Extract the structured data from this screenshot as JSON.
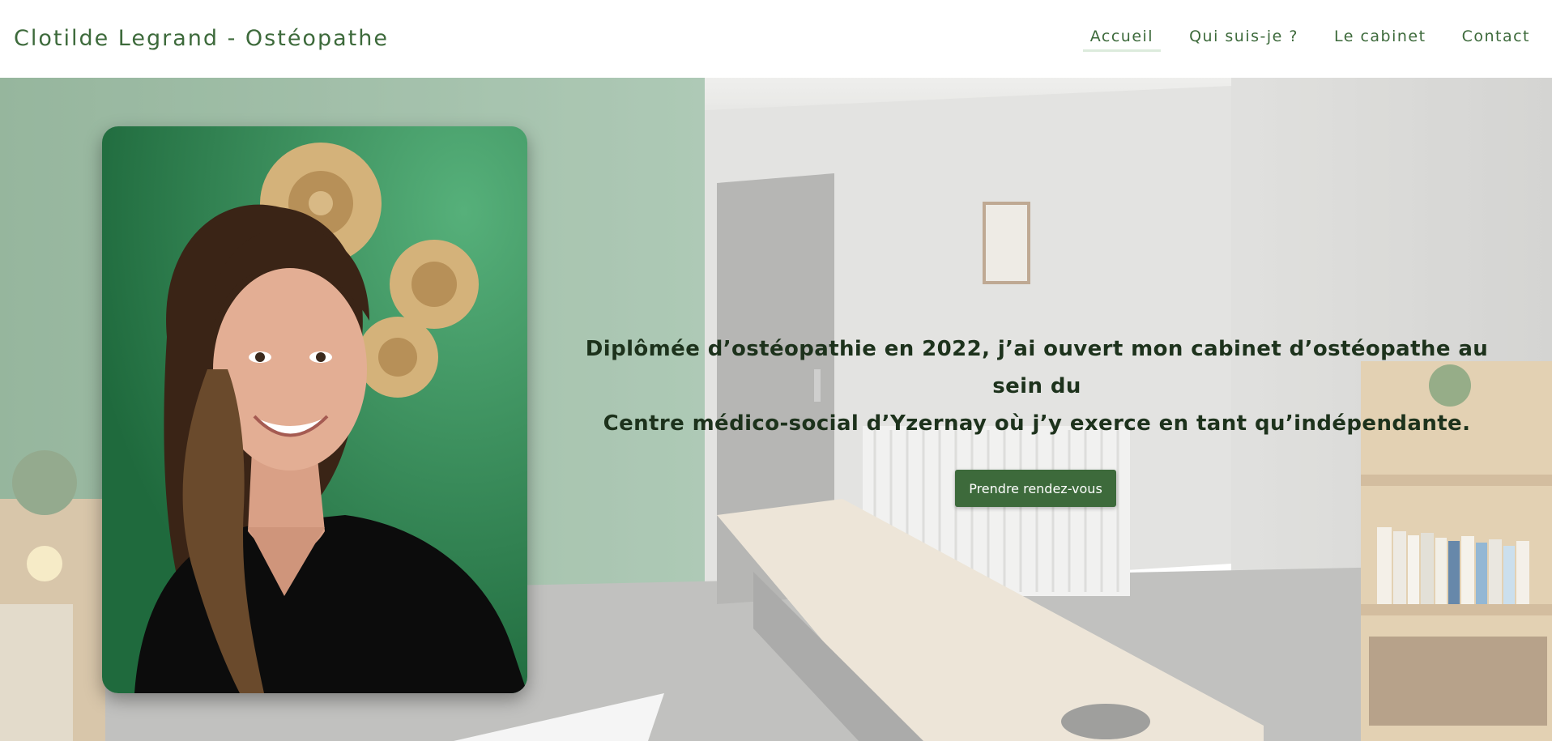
{
  "header": {
    "site_title": "Clotilde Legrand - Ostéopathe",
    "nav": [
      {
        "label": "Accueil",
        "active": true
      },
      {
        "label": "Qui suis-je ?"
      },
      {
        "label": "Le cabinet"
      },
      {
        "label": "Contact"
      }
    ]
  },
  "hero": {
    "tagline_line1": "Diplômée d’ostéopathie en 2022, j’ai ouvert mon cabinet d’ostéopathe au sein du",
    "tagline_line2": "Centre médico-social d’Yzernay où j’y exerce en tant qu’indépendante.",
    "cta_label": "Prendre rendez-vous"
  },
  "colors": {
    "brand_green": "#3d6a3b",
    "text_dark": "#1d321c",
    "nav_active_underline": "#dcebdc"
  }
}
